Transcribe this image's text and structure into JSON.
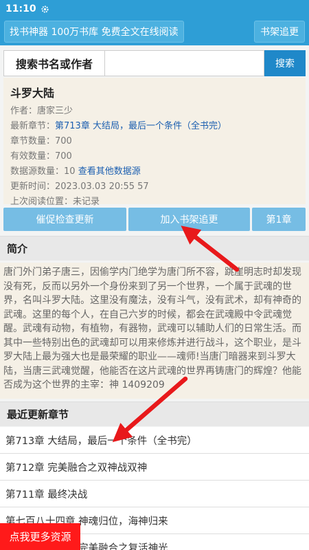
{
  "status": {
    "time": "11:10"
  },
  "topbar": {
    "promo": "找书神器 100万书库 免费全文在线阅读",
    "bookshelf": "书架追更"
  },
  "search": {
    "label": "搜索书名或作者",
    "value": "",
    "button": "搜索"
  },
  "book": {
    "title": "斗罗大陆",
    "author": "作者：唐家三少",
    "latest_prefix": "最新章节：",
    "latest_chapter": "第713章 大结局，最后一个条件（全书完）",
    "chapter_count": "章节数量：700",
    "valid_count": "有效数量：700",
    "source_prefix": "数据源数量：10 ",
    "source_link": "查看其他数据源",
    "updated": "更新时间：2023.03.03 20:55 57",
    "last_read": "上次阅读位置：未记录"
  },
  "actions": {
    "urge": "催促检查更新",
    "add": "加入书架追更",
    "first": "第1章"
  },
  "intro": {
    "heading": "简介",
    "text": "唐门外门弟子唐三，因偷学内门绝学为唐门所不容，跳崖明志时却发现没有死，反而以另外一个身份来到了另一个世界，一个属于武魂的世界，名叫斗罗大陆。这里没有魔法，没有斗气，没有武术，却有神奇的武魂。这里的每个人，在自己六岁的时候，都会在武魂殿中令武魂觉醒。武魂有动物，有植物，有器物，武魂可以辅助人们的日常生活。而其中一些特别出色的武魂却可以用来修炼并进行战斗，这个职业，是斗罗大陆上最为强大也是最荣耀的职业——魂师!当唐门暗器来到斗罗大陆，当唐三武魂觉醒，他能否在这片武魂的世界再铸唐门的辉煌？他能否成为这个世界的主宰：神 1409209"
  },
  "recent": {
    "heading": "最近更新章节",
    "chapters": [
      "第713章 大结局，最后一个条件（全书完）",
      "第712章 完美融合之双神战双神",
      "第711章 最终决战",
      "第七百八十四章 神魂归位，海神归来",
      "第七百八十三章 完美融合之复活神光"
    ]
  },
  "cta": {
    "label": "点我更多资源"
  },
  "colors": {
    "primary": "#2e9ed6",
    "action": "#76bde4",
    "cta": "#ff1a1a",
    "arrow": "#e8191b"
  }
}
